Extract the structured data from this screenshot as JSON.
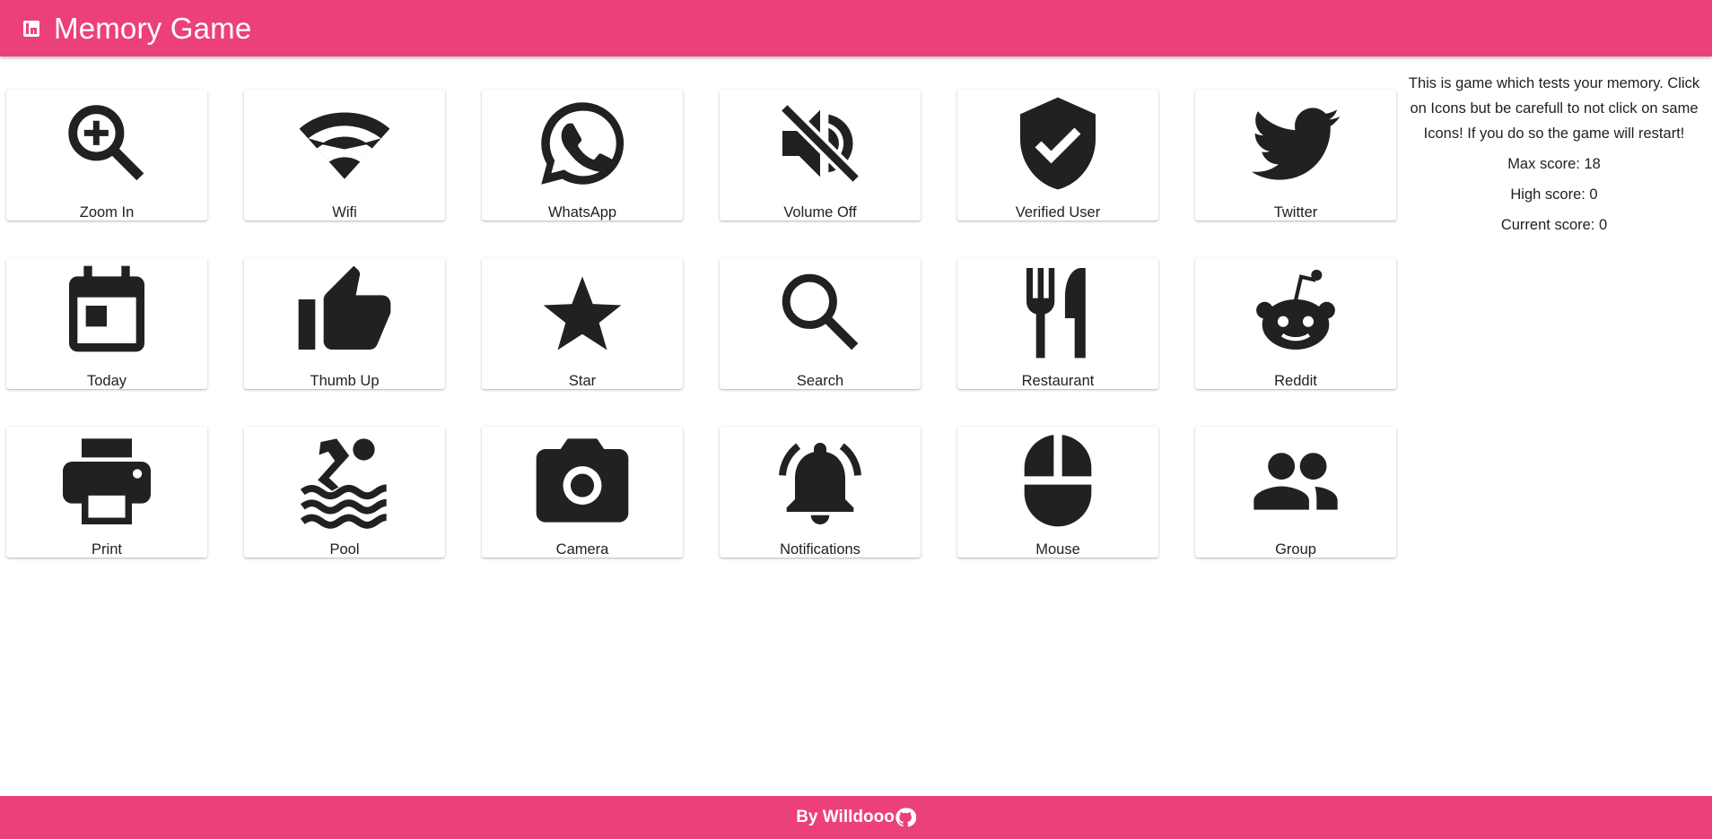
{
  "header": {
    "title": "Memory Game",
    "logo_icon": "grid-icon"
  },
  "cards": [
    {
      "label": "Zoom In",
      "icon": "zoom-in-icon"
    },
    {
      "label": "Wifi",
      "icon": "wifi-icon"
    },
    {
      "label": "WhatsApp",
      "icon": "whatsapp-icon"
    },
    {
      "label": "Volume Off",
      "icon": "volume-off-icon"
    },
    {
      "label": "Verified User",
      "icon": "verified-user-icon"
    },
    {
      "label": "Twitter",
      "icon": "twitter-icon"
    },
    {
      "label": "Today",
      "icon": "today-icon"
    },
    {
      "label": "Thumb Up",
      "icon": "thumb-up-icon"
    },
    {
      "label": "Star",
      "icon": "star-icon"
    },
    {
      "label": "Search",
      "icon": "search-icon"
    },
    {
      "label": "Restaurant",
      "icon": "restaurant-icon"
    },
    {
      "label": "Reddit",
      "icon": "reddit-icon"
    },
    {
      "label": "Print",
      "icon": "print-icon"
    },
    {
      "label": "Pool",
      "icon": "pool-icon"
    },
    {
      "label": "Camera",
      "icon": "camera-icon"
    },
    {
      "label": "Notifications",
      "icon": "notifications-icon"
    },
    {
      "label": "Mouse",
      "icon": "mouse-icon"
    },
    {
      "label": "Group",
      "icon": "group-icon"
    }
  ],
  "info": {
    "description": "This is game which tests your memory. Click on Icons but be carefull to not click on same Icons! If you do so the game will restart!",
    "max_score": "Max score: 18",
    "high_score": "High score: 0",
    "current_score": "Current score: 0"
  },
  "footer": {
    "text": "By Willdooo",
    "github_icon": "github-icon"
  },
  "colors": {
    "accent": "#ec407a",
    "icon": "#212121",
    "card_bg": "#ffffff"
  }
}
